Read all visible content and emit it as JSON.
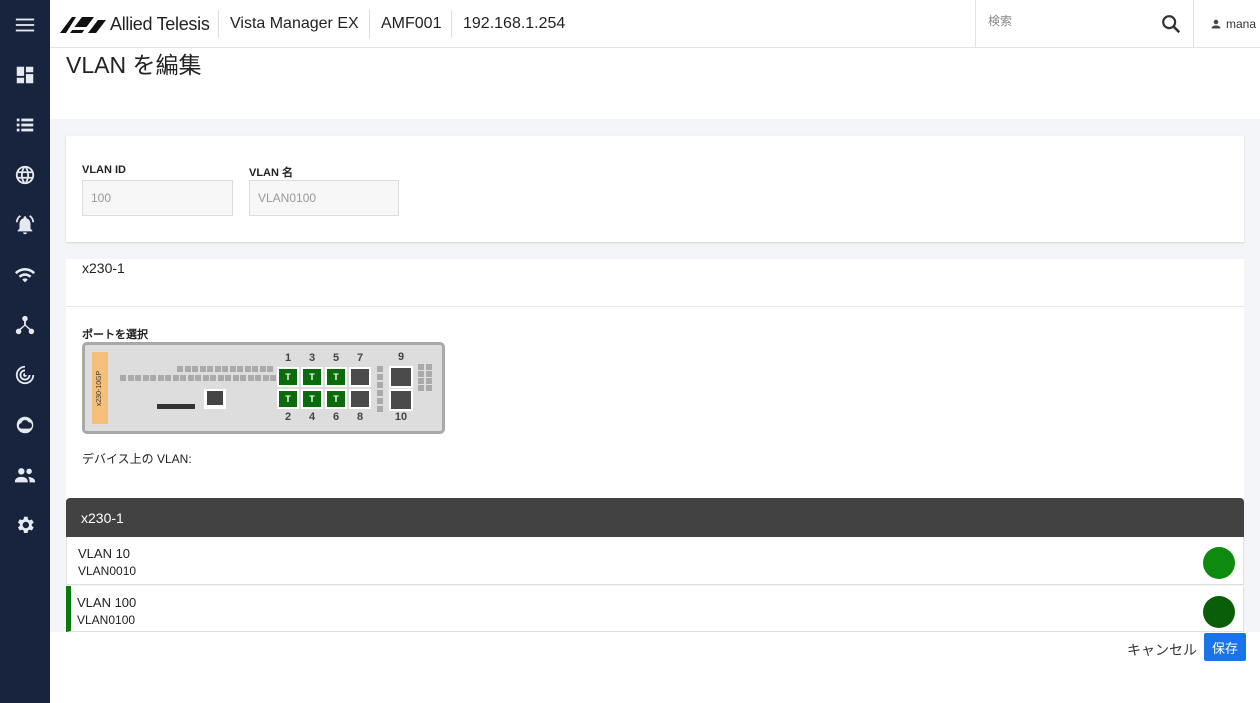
{
  "header": {
    "brand": "Allied Telesis",
    "app_name": "Vista Manager EX",
    "device": "AMF001",
    "ip": "192.168.1.254",
    "search_placeholder": "検索",
    "user": "mana"
  },
  "sidebar": {
    "items": [
      {
        "icon": "menu-icon"
      },
      {
        "icon": "dashboard-icon"
      },
      {
        "icon": "list-icon"
      },
      {
        "icon": "globe-icon"
      },
      {
        "icon": "alarm-icon"
      },
      {
        "icon": "wifi-icon"
      },
      {
        "icon": "topology-icon"
      },
      {
        "icon": "radar-icon"
      },
      {
        "icon": "cloud-icon"
      },
      {
        "icon": "users-icon"
      },
      {
        "icon": "settings-icon"
      }
    ],
    "color": "#18243d"
  },
  "page": {
    "title": "VLAN を編集"
  },
  "form": {
    "vlan_id_label": "VLAN ID",
    "vlan_id_value": "100",
    "vlan_name_label": "VLAN 名",
    "vlan_name_value": "VLAN0100"
  },
  "device": {
    "name": "x230-1",
    "port_select_label": "ポートを選択",
    "model": "x230-10GP",
    "ports": [
      {
        "num": "1",
        "tag": "T",
        "state": "tagged"
      },
      {
        "num": "2",
        "tag": "T",
        "state": "tagged"
      },
      {
        "num": "3",
        "tag": "T",
        "state": "tagged"
      },
      {
        "num": "4",
        "tag": "T",
        "state": "tagged"
      },
      {
        "num": "5",
        "tag": "T",
        "state": "tagged"
      },
      {
        "num": "6",
        "tag": "T",
        "state": "tagged"
      },
      {
        "num": "7",
        "tag": "",
        "state": "none"
      },
      {
        "num": "8",
        "tag": "",
        "state": "none"
      },
      {
        "num": "9",
        "tag": "",
        "state": "none"
      },
      {
        "num": "10",
        "tag": "",
        "state": "none"
      }
    ],
    "vlans_on_device_label": "デバイス上の VLAN:"
  },
  "vlan_list": {
    "header": "x230-1",
    "items": [
      {
        "name": "VLAN 10",
        "sub": "VLAN0010",
        "color": "#0e8a0e",
        "selected": false
      },
      {
        "name": "VLAN 100",
        "sub": "VLAN0100",
        "color": "#0a5e0a",
        "selected": true
      }
    ]
  },
  "footer": {
    "cancel": "キャンセル",
    "save": "保存"
  },
  "colors": {
    "accent": "#1a73e8",
    "tagged_port": "#0a6b0a"
  }
}
